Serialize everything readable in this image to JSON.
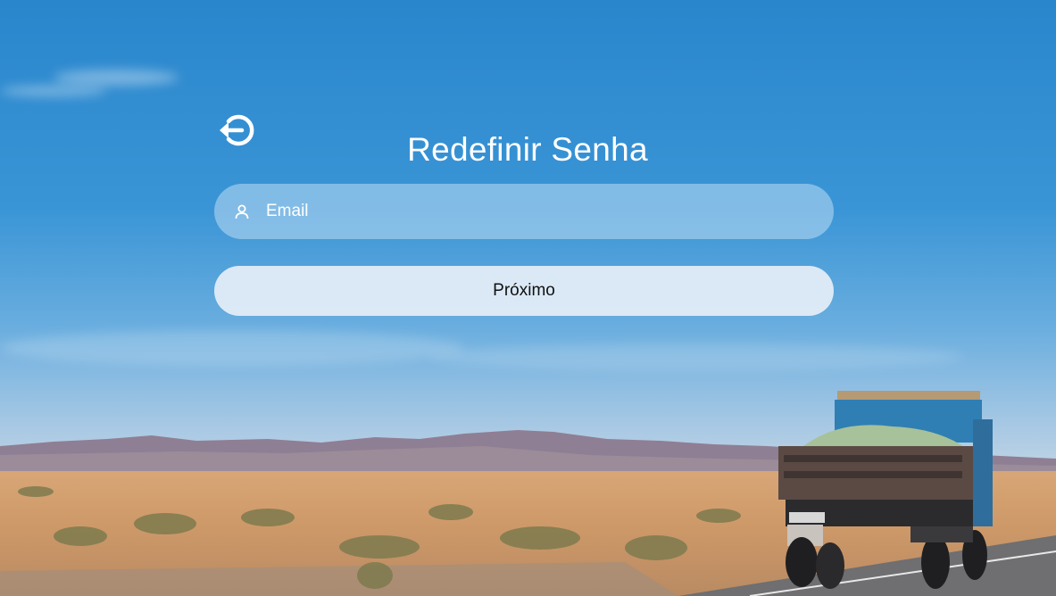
{
  "page": {
    "title": "Redefinir Senha"
  },
  "form": {
    "email_placeholder": "Email",
    "email_value": "",
    "submit_label": "Próximo"
  },
  "icons": {
    "back": "logout-arrow-icon",
    "email": "user-icon"
  },
  "colors": {
    "text": "#ffffff",
    "field_background": "rgba(190,220,244,0.55)",
    "button_background": "#e6eff7",
    "button_text": "#111111",
    "sky": "#2a86cc"
  }
}
